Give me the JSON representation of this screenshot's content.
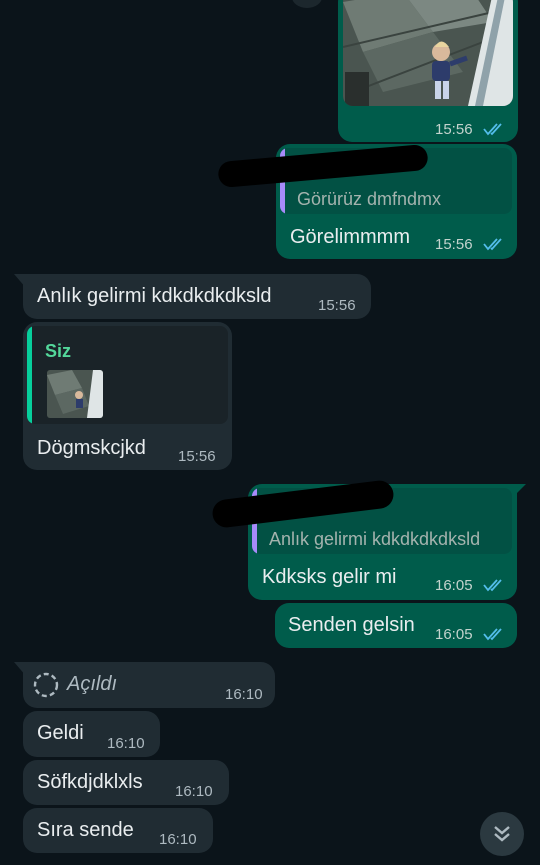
{
  "messages": {
    "photo_msg": {
      "time": "15:56"
    },
    "reply_msg": {
      "quoted": "Görürüz dmfndmx",
      "text": "Görelimmmm",
      "time": "15:56"
    },
    "incoming_1": {
      "text": "Anlık gelirmi kdkdkdkdksld",
      "time": "15:56"
    },
    "incoming_reply": {
      "quoted_author": "Siz",
      "text": "Dögmskcjkd",
      "time": "15:56"
    },
    "reply_msg_2": {
      "quoted": "Anlık gelirmi kdkdkdkdksld",
      "text": "Kdksks gelir mi",
      "time": "16:05"
    },
    "out_2": {
      "text": "Senden gelsin",
      "time": "16:05"
    },
    "view_once": {
      "label": "Açıldı",
      "time": "16:10"
    },
    "incoming_2": {
      "text": "Geldi",
      "time": "16:10"
    },
    "incoming_3": {
      "text": "Söfkdjdklxls",
      "time": "16:10"
    },
    "incoming_4": {
      "text": "Sıra sende",
      "time": "16:10"
    }
  },
  "colors": {
    "background": "#0b141a",
    "outgoing_bubble": "#005c4b",
    "incoming_bubble": "#202c33",
    "read_ticks": "#53bdeb",
    "quote_author": "#53d79a",
    "quote_bar_in": "#06cf9c",
    "quote_bar_out": "#a78bfa"
  },
  "icons": {
    "read_ticks": "double-check-icon",
    "view_once": "view-once-icon",
    "scroll_down": "double-chevron-down-icon"
  }
}
